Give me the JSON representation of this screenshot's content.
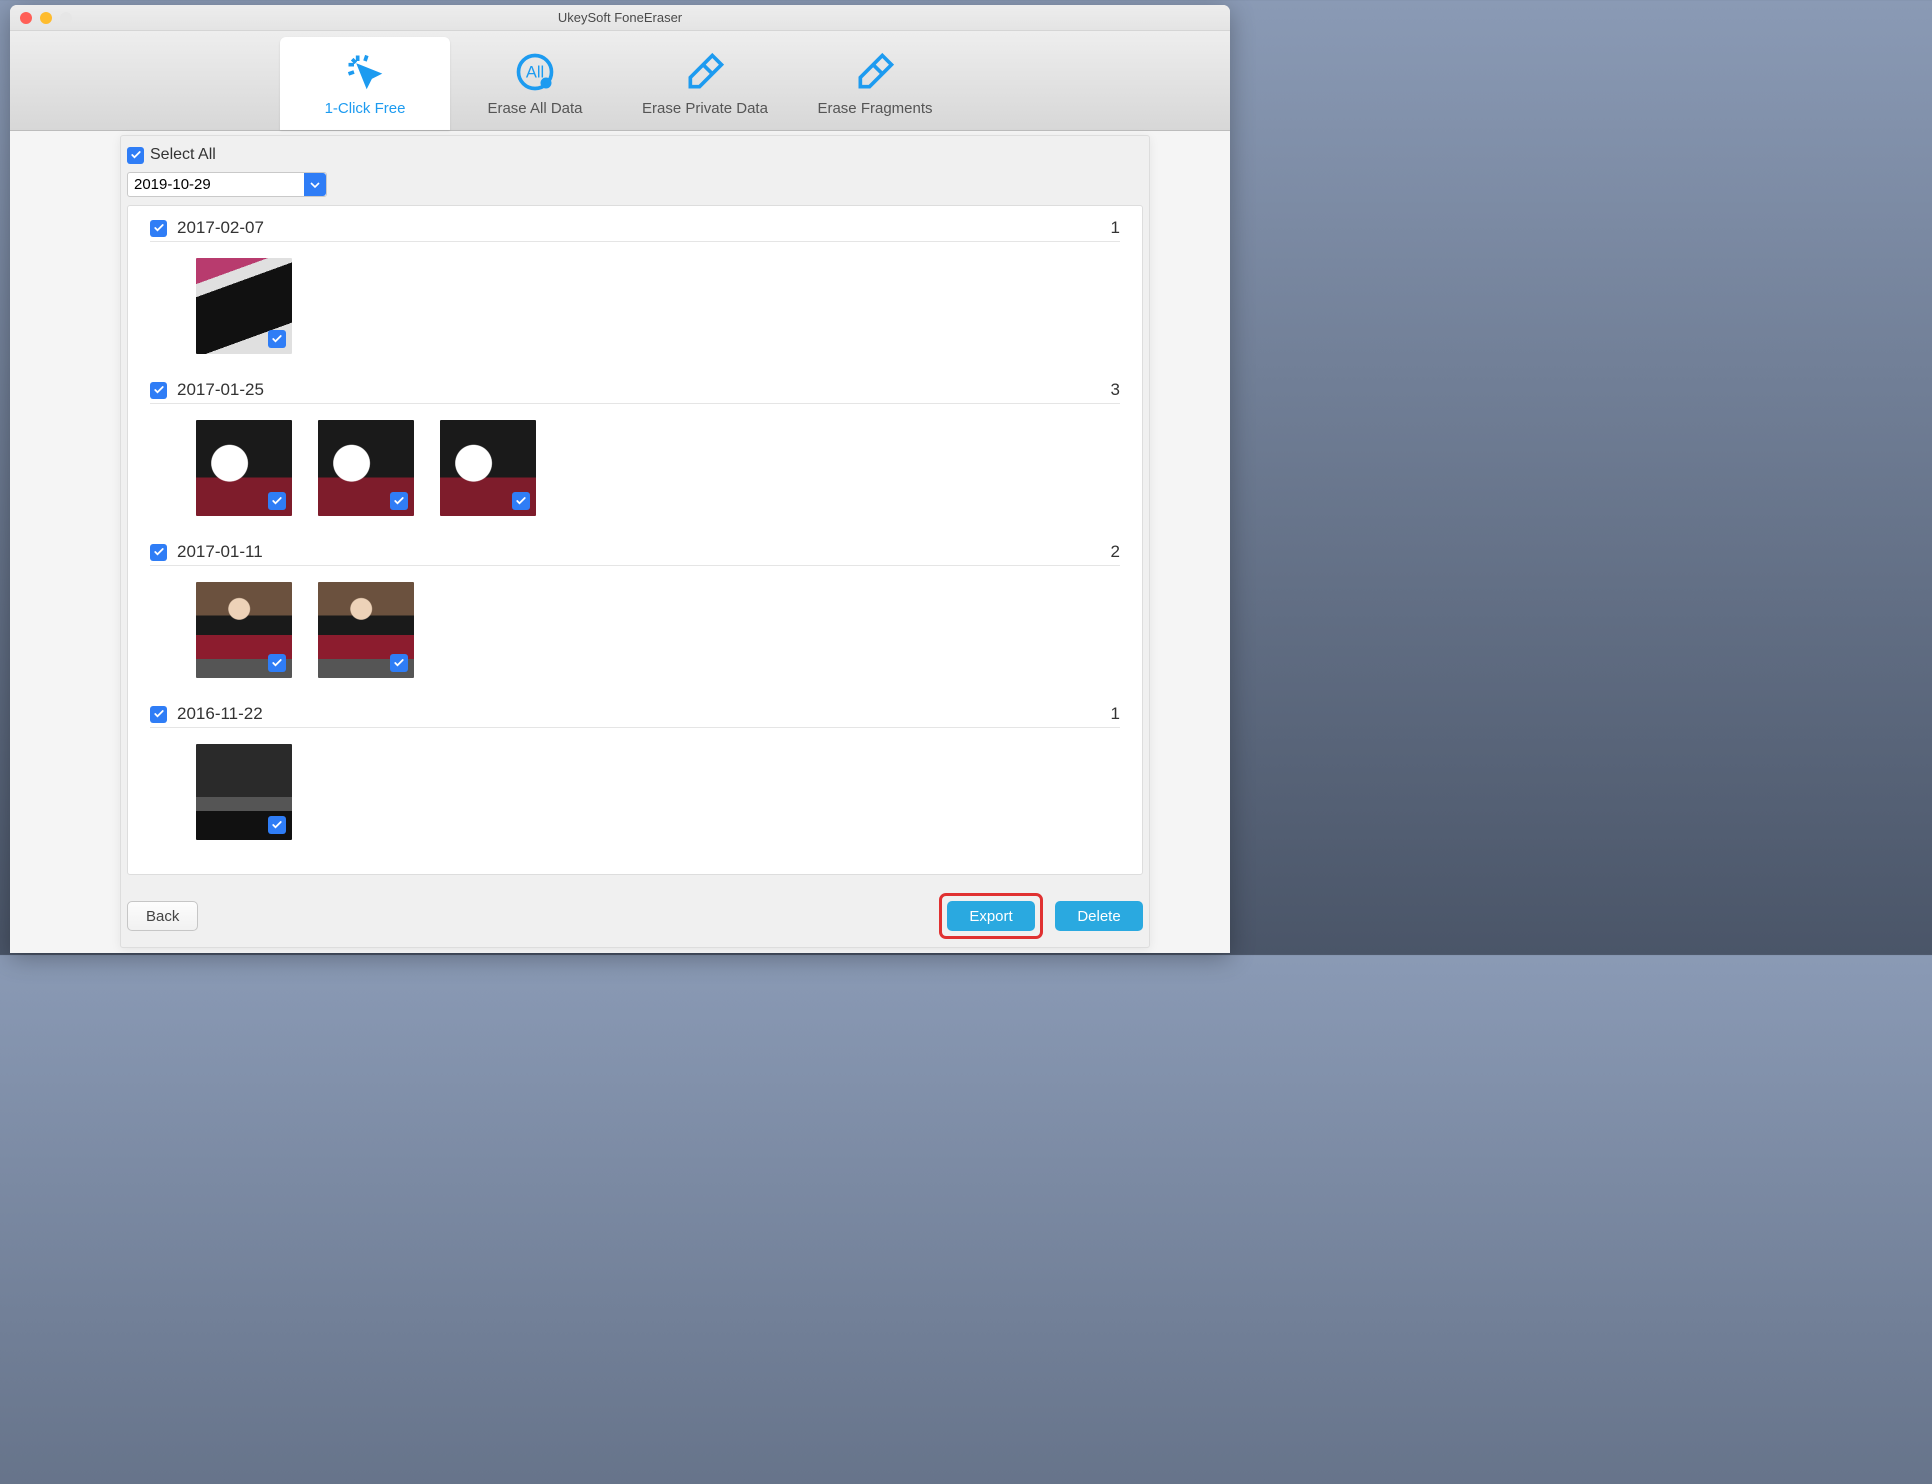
{
  "window": {
    "title": "UkeySoft FoneEraser"
  },
  "tabs": [
    {
      "label": "1-Click Free",
      "active": true
    },
    {
      "label": "Erase All Data",
      "active": false
    },
    {
      "label": "Erase Private Data",
      "active": false
    },
    {
      "label": "Erase Fragments",
      "active": false
    }
  ],
  "filters": {
    "select_all_label": "Select All",
    "select_all_checked": true,
    "date_value": "2019-10-29"
  },
  "groups": [
    {
      "date": "2017-02-07",
      "count": 1,
      "checked": true,
      "thumbs": [
        {
          "art": "art-phone"
        }
      ]
    },
    {
      "date": "2017-01-25",
      "count": 3,
      "checked": true,
      "thumbs": [
        {
          "art": "art-cat"
        },
        {
          "art": "art-cat"
        },
        {
          "art": "art-cat"
        }
      ]
    },
    {
      "date": "2017-01-11",
      "count": 2,
      "checked": true,
      "thumbs": [
        {
          "art": "art-girl"
        },
        {
          "art": "art-girl"
        }
      ]
    },
    {
      "date": "2016-11-22",
      "count": 1,
      "checked": true,
      "thumbs": [
        {
          "art": "art-car"
        }
      ]
    }
  ],
  "footer": {
    "back_label": "Back",
    "export_label": "Export",
    "delete_label": "Delete"
  }
}
